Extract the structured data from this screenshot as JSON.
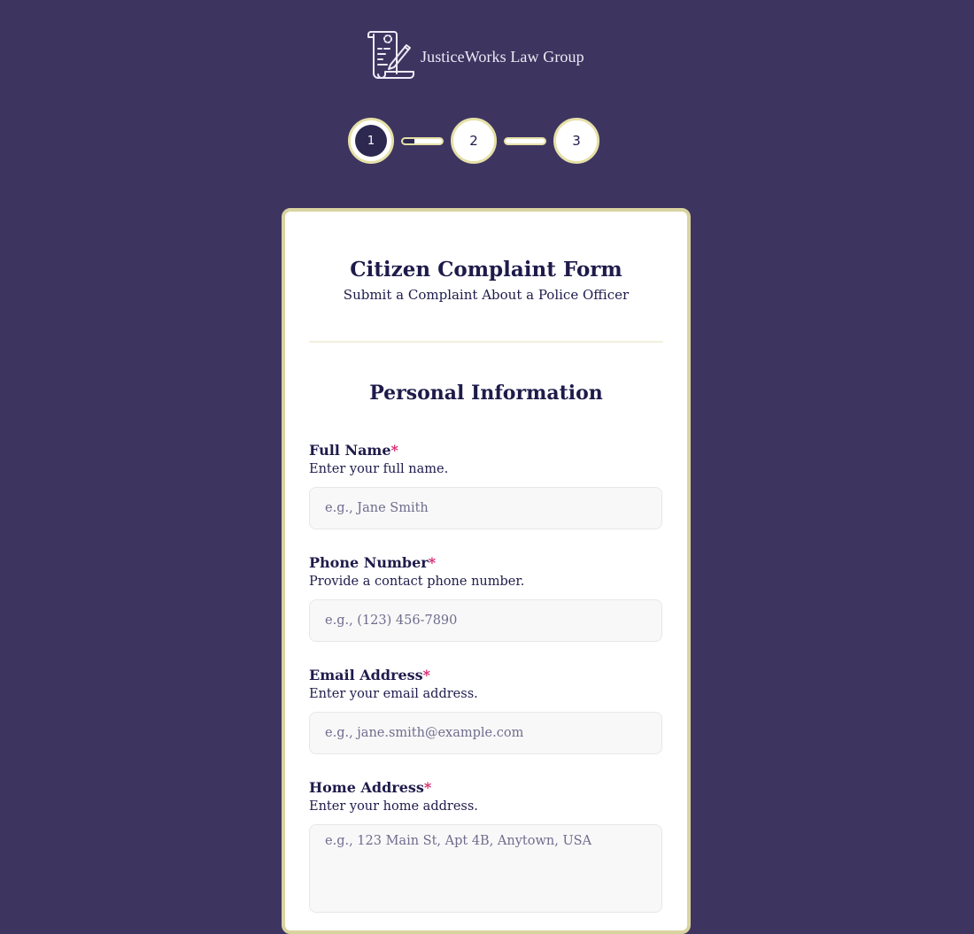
{
  "brand": {
    "name": "JusticeWorks Law Group",
    "logo_icon": "scroll-pen-icon"
  },
  "stepper": {
    "steps": [
      {
        "label": "1",
        "state": "active"
      },
      {
        "label": "2",
        "state": "pending"
      },
      {
        "label": "3",
        "state": "pending"
      }
    ],
    "connector_progress": [
      0.3,
      0
    ]
  },
  "form": {
    "title": "Citizen Complaint Form",
    "subtitle": "Submit a Complaint About a Police Officer",
    "section_title": "Personal Information",
    "required_marker": "*",
    "fields": [
      {
        "label": "Full Name",
        "help": "Enter your full name.",
        "placeholder": "e.g., Jane Smith",
        "value": ""
      },
      {
        "label": "Phone Number",
        "help": "Provide a contact phone number.",
        "placeholder": "e.g., (123) 456-7890",
        "value": ""
      },
      {
        "label": "Email Address",
        "help": "Enter your email address.",
        "placeholder": "e.g., jane.smith@example.com",
        "value": ""
      },
      {
        "label": "Home Address",
        "help": "Enter your home address.",
        "placeholder": "e.g., 123 Main St, Apt 4B, Anytown, USA",
        "value": ""
      }
    ]
  },
  "colors": {
    "background": "#3d3560",
    "accent_border": "#d9d3a0",
    "text": "#1e1b4b",
    "required": "#d6246e"
  }
}
